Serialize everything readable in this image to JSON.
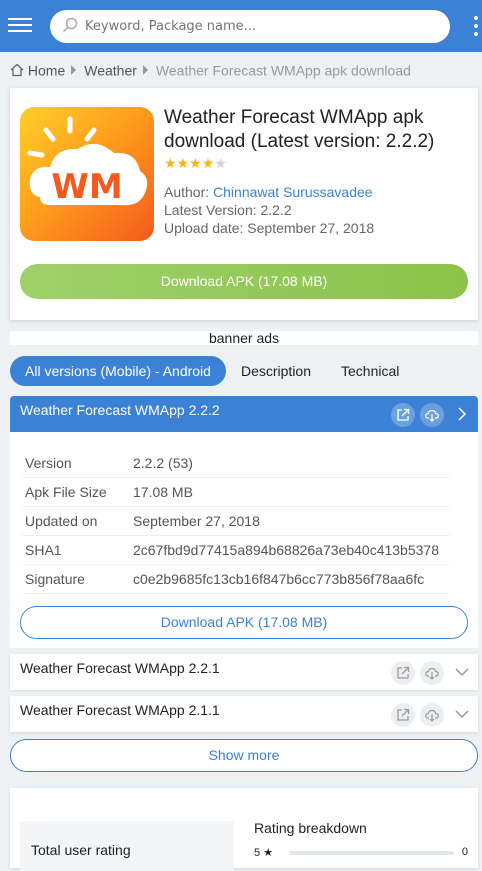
{
  "header": {
    "search_placeholder": "Keyword, Package name..."
  },
  "breadcrumb": {
    "home": "Home",
    "category": "Weather",
    "current": "Weather Forecast WMApp apk download"
  },
  "app": {
    "title": "Weather Forecast WMApp apk download (Latest version: 2.2.2)",
    "rating_stars": 4,
    "rating_max": 5,
    "author_label": "Author:",
    "author": "Chinnawat Surussavadee",
    "latest_version": "Latest Version: 2.2.2",
    "upload_date": "Upload date: September 27, 2018",
    "download_label": "Download APK (17.08 MB)",
    "icon_text": "WM"
  },
  "banner": "banner ads",
  "tabs": [
    {
      "label": "All versions (Mobile) - Android"
    },
    {
      "label": "Description"
    },
    {
      "label": "Technical"
    }
  ],
  "versions": [
    {
      "title": "Weather Forecast WMApp 2.2.2",
      "specs": [
        {
          "key": "Version",
          "value": "2.2.2 (53)"
        },
        {
          "key": "Apk File Size",
          "value": "17.08 MB"
        },
        {
          "key": "Updated on",
          "value": "September 27, 2018"
        },
        {
          "key": "SHA1",
          "value": "2c67fbd9d77415a894b68826a73eb40c413b5378"
        },
        {
          "key": "Signature",
          "value": "c0e2b9685fc13cb16f847b6cc773b856f78aa6fc"
        }
      ],
      "download_label": "Download APK (17.08 MB)"
    },
    {
      "title": "Weather Forecast WMApp 2.2.1"
    },
    {
      "title": "Weather Forecast WMApp 2.1.1"
    }
  ],
  "show_more": "Show more",
  "rating": {
    "total_label": "Total user rating",
    "breakdown_title": "Rating breakdown",
    "row_star": "5",
    "row_count": "0"
  },
  "colors": {
    "primary": "#3b82d6",
    "download_green": "#8bc34a",
    "star": "#f6b511"
  }
}
